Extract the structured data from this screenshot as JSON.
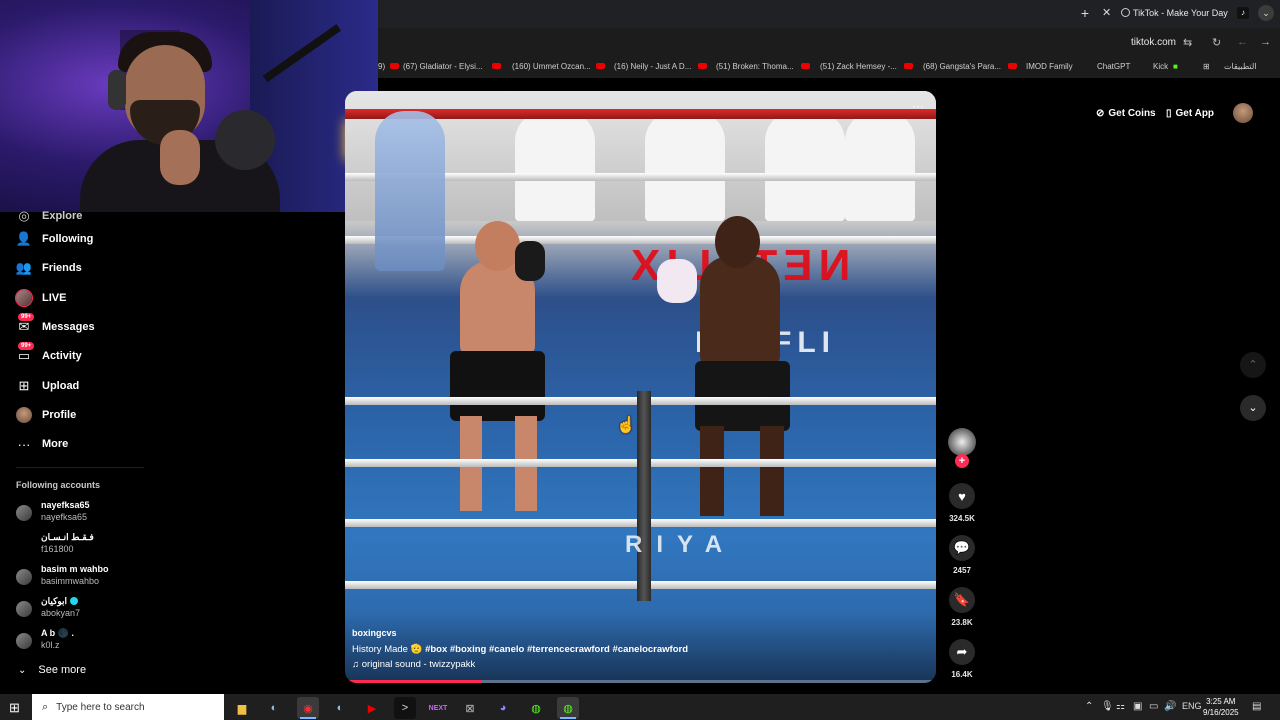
{
  "browser": {
    "tab_title": "TikTok - Make Your Day",
    "url": "tiktok.com",
    "bookmarks": [
      "(67) Gladiator - Elysi...",
      "(160) Ummet Ozcan...",
      "(16) Neily - Just A D...",
      "(51) Broken: Thoma...",
      "(51) Zack Hemsey -...",
      "(68) Gangsta's Para...",
      "IMOD Family",
      "ChatGPT",
      "Kick",
      "التطبيقات"
    ],
    "bookmark_partial": "9)"
  },
  "sidebar": {
    "partial_item": "Explore",
    "items": [
      {
        "label": "Following",
        "icon": "following-icon"
      },
      {
        "label": "Friends",
        "icon": "friends-icon"
      },
      {
        "label": "LIVE",
        "icon": "live-avatar"
      },
      {
        "label": "Messages",
        "icon": "messages-icon",
        "badge": "99+"
      },
      {
        "label": "Activity",
        "icon": "activity-icon",
        "badge": "99+"
      },
      {
        "label": "Upload",
        "icon": "upload-icon"
      },
      {
        "label": "Profile",
        "icon": "profile-avatar"
      },
      {
        "label": "More",
        "icon": "more-icon"
      }
    ],
    "following_title": "Following accounts",
    "accounts": [
      {
        "name": "nayefksa65",
        "username": "nayefksa65"
      },
      {
        "name": "فـقـط انـسـان",
        "username": "f161800"
      },
      {
        "name": "basim m wahbo",
        "username": "basimmwahbo"
      },
      {
        "name": "ابوكيان",
        "username": "abokyan7",
        "verified": true
      },
      {
        "name": "A b 🌑 .",
        "username": "k0l.z"
      }
    ],
    "see_more": "See more"
  },
  "video": {
    "author": "boxingcvs",
    "caption_text": "History Made 🫡",
    "hashtags": "#box #boxing #canelo #terrencecrawford #canelocrawford",
    "sound": "original sound - twizzypakk",
    "progress_fraction": 0.23,
    "overlay_texts": {
      "netflix": "NETFLIX",
      "mat1": "NETFLI",
      "mat2": "RIYA"
    }
  },
  "actions": {
    "likes": "324.5K",
    "comments": "2457",
    "saves": "23.8K",
    "shares": "16.4K"
  },
  "header": {
    "get_coins": "Get Coins",
    "get_app": "Get App"
  },
  "taskbar": {
    "search_placeholder": "Type here to search",
    "language": "ENG",
    "time": "3:25 AM",
    "date": "9/16/2025"
  }
}
